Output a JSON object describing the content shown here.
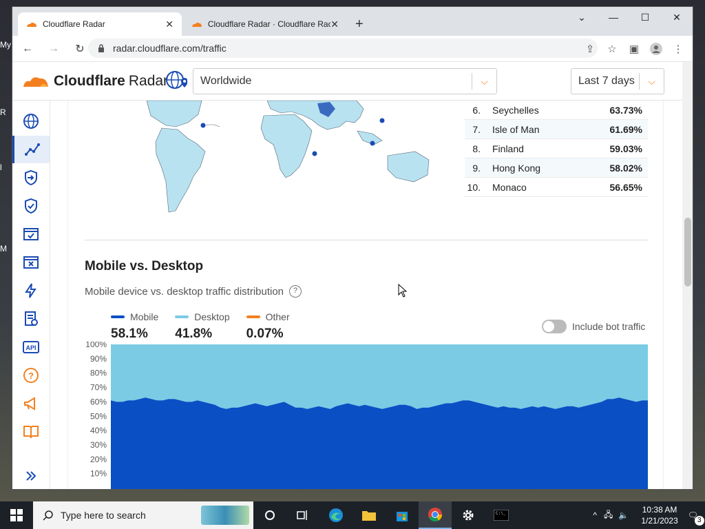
{
  "desktop": {
    "labels": [
      "My",
      "R",
      "l",
      "M"
    ]
  },
  "browser": {
    "tabs": [
      {
        "title": "Cloudflare Radar",
        "active": true
      },
      {
        "title": "Cloudflare Radar · Cloudflare Rac",
        "active": false
      }
    ],
    "url": "radar.cloudflare.com/traffic"
  },
  "header": {
    "brand_bold": "Cloudflare",
    "brand_light": "Radar",
    "location": "Worldwide",
    "date_range": "Last 7 days"
  },
  "ranking": [
    {
      "rank": "6.",
      "country": "Seychelles",
      "pct": "63.73%"
    },
    {
      "rank": "7.",
      "country": "Isle of Man",
      "pct": "61.69%"
    },
    {
      "rank": "8.",
      "country": "Finland",
      "pct": "59.03%"
    },
    {
      "rank": "9.",
      "country": "Hong Kong",
      "pct": "58.02%"
    },
    {
      "rank": "10.",
      "country": "Monaco",
      "pct": "56.65%"
    }
  ],
  "section": {
    "title": "Mobile vs. Desktop",
    "subtitle": "Mobile device vs. desktop traffic distribution",
    "toggle_label": "Include bot traffic",
    "legend": [
      {
        "name": "Mobile",
        "value": "58.1%",
        "color": "#0a4fc4"
      },
      {
        "name": "Desktop",
        "value": "41.8%",
        "color": "#7bcbe4"
      },
      {
        "name": "Other",
        "value": "0.07%",
        "color": "#f38020"
      }
    ]
  },
  "chart_data": {
    "type": "area",
    "title": "",
    "xlabel": "",
    "ylabel": "",
    "ylim": [
      0,
      100
    ],
    "y_ticks": [
      "100%",
      "90%",
      "80%",
      "70%",
      "60%",
      "50%",
      "40%",
      "30%",
      "20%",
      "10%"
    ],
    "series": [
      {
        "name": "Mobile",
        "values": [
          61,
          60,
          60,
          61,
          61,
          62,
          63,
          62,
          61,
          61,
          62,
          62,
          61,
          60,
          60,
          61,
          60,
          59,
          58,
          56,
          55,
          56,
          56,
          57,
          58,
          59,
          58,
          57,
          58,
          59,
          60,
          58,
          56,
          56,
          55,
          56,
          57,
          56,
          55,
          57,
          58,
          59,
          58,
          57,
          58,
          57,
          56,
          55,
          56,
          57,
          58,
          58,
          57,
          55,
          56,
          56,
          57,
          58,
          59,
          59,
          60,
          61,
          61,
          60,
          59,
          58,
          57,
          56,
          57,
          56,
          56,
          55,
          56,
          57,
          56,
          57,
          56,
          55,
          56,
          57,
          57,
          56,
          57,
          58,
          59,
          60,
          62,
          62,
          63,
          62,
          61,
          60,
          61,
          61
        ]
      },
      {
        "name": "Desktop",
        "values": [
          39,
          40,
          40,
          39,
          39,
          38,
          37,
          38,
          39,
          39,
          38,
          38,
          39,
          40,
          40,
          39,
          40,
          41,
          42,
          44,
          45,
          44,
          44,
          43,
          42,
          41,
          42,
          43,
          42,
          41,
          40,
          42,
          44,
          44,
          45,
          44,
          43,
          44,
          45,
          43,
          42,
          41,
          42,
          43,
          42,
          43,
          44,
          45,
          44,
          43,
          42,
          42,
          43,
          45,
          44,
          44,
          43,
          42,
          41,
          41,
          40,
          39,
          39,
          40,
          41,
          42,
          43,
          44,
          43,
          44,
          44,
          45,
          44,
          43,
          44,
          43,
          44,
          45,
          44,
          43,
          43,
          44,
          43,
          42,
          41,
          40,
          38,
          38,
          37,
          38,
          39,
          40,
          39,
          39
        ]
      }
    ]
  },
  "taskbar": {
    "search_placeholder": "Type here to search",
    "time": "10:38 AM",
    "date": "1/21/2023",
    "notifications": "3"
  }
}
